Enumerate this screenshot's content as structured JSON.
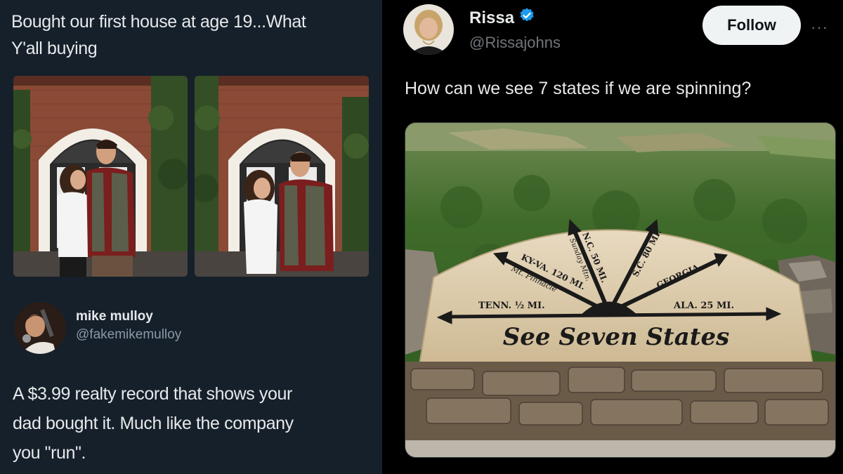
{
  "left_post": {
    "text_line1": "Bought our first house at age 19...What",
    "text_line2": "Y'all buying"
  },
  "reply": {
    "name": "mike mulloy",
    "handle": "@fakemikemulloy",
    "text_line1": "A $3.99 realty record that shows your",
    "text_line2": "dad bought it. Much like the company",
    "text_line3": "you \"run\"."
  },
  "right_post": {
    "name": "Rissa",
    "handle": "@Rissajohns",
    "follow_label": "Follow",
    "more_label": "···",
    "text": "How can we see 7 states if we are spinning?"
  },
  "sign": {
    "title": "See Seven States",
    "nc": "N.C. 50 MI.",
    "sunday": "Sunday Mtn.",
    "sc": "S.C. 80 MI.",
    "kyva": "KY-VA. 120 MI.",
    "pinnacle": "Mt. Pinnacle",
    "georgia": "GEORGIA",
    "tenn": "TENN. ½ MI.",
    "ala": "ALA. 25 MI."
  },
  "colors": {
    "left_bg": "#15202b",
    "right_bg": "#000000",
    "verified": "#1d9bf0"
  }
}
